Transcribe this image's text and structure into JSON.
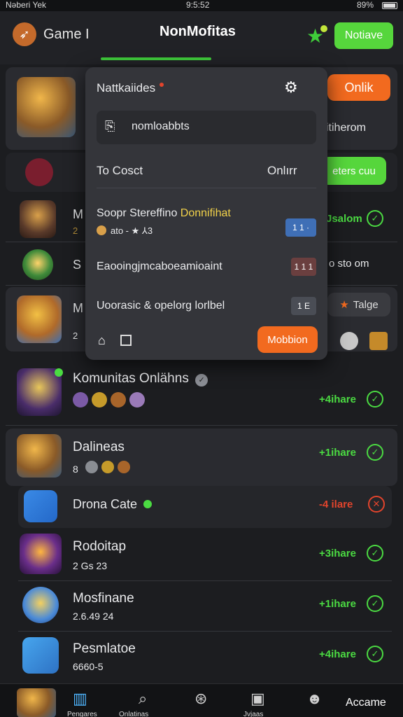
{
  "status": {
    "carrier": "Nəberi Yek",
    "time": "9:5:52",
    "battery": "89%"
  },
  "header": {
    "brand": "Game",
    "separator": "I",
    "title": "NonMofitas",
    "action_label": "Notiave"
  },
  "top_card": {
    "action_label": "Onlik",
    "side_text": "itiherom"
  },
  "second_card": {
    "action_label": "eters cuu"
  },
  "partial_rows": [
    {
      "title_fragment": "M",
      "sub_fragment": "2",
      "right_text": "Jsalom"
    },
    {
      "title_fragment": "S",
      "right_text": "o sto om"
    },
    {
      "title_fragment": "M",
      "sub_fragment": "2",
      "right_label": "Talge"
    }
  ],
  "community_row": {
    "title": "Komunitas Onlähns",
    "status": "+4ihare"
  },
  "list": [
    {
      "title": "Dalineas",
      "sub": "8",
      "status": "+1ihare",
      "status_color": "#4bdb42"
    },
    {
      "title": "Drona Cate",
      "sub": "",
      "status": "-4 ilare",
      "status_color": "#e2442c"
    },
    {
      "title": "Rodoitap",
      "sub": "2 Gs 23",
      "status": "+3ihare",
      "status_color": "#4bdb42"
    },
    {
      "title": "Mosfinane",
      "sub": "2.6.49 24",
      "status": "+1ihare",
      "status_color": "#4bdb42"
    },
    {
      "title": "Pesmlatoe",
      "sub": "6660-5",
      "status": "+4ihare",
      "status_color": "#4bdb42"
    }
  ],
  "overlay": {
    "title": "Nattkaiides",
    "source_label": "nomloabbts",
    "to_label": "To Cosct",
    "to_value": "Onlırr",
    "items": [
      {
        "title_a": "Soopr Stereffino ",
        "title_b": "Donnifihat",
        "sub": "ato - ★ ⅄3",
        "badge": "1 1 ·",
        "badge_color": "#3f6fb6"
      },
      {
        "title_a": "Eaooingjmcaboeamioaint",
        "title_b": "",
        "sub": "",
        "badge": "1 1 1",
        "badge_color": "#6a3f3f"
      },
      {
        "title_a": "Uoorasic & opelorg lorlbel",
        "title_b": "",
        "sub": "",
        "badge": "1 E",
        "badge_color": "#4a4d55"
      }
    ],
    "footer_button": "Mobbion"
  },
  "bottom_nav": {
    "labels": [
      "Pengares",
      "Onlatinas",
      "Jvjaas",
      "",
      "Accame"
    ]
  },
  "colors": {
    "green": "#4bdb42",
    "orange": "#f26a1f",
    "panel": "#34353a"
  }
}
